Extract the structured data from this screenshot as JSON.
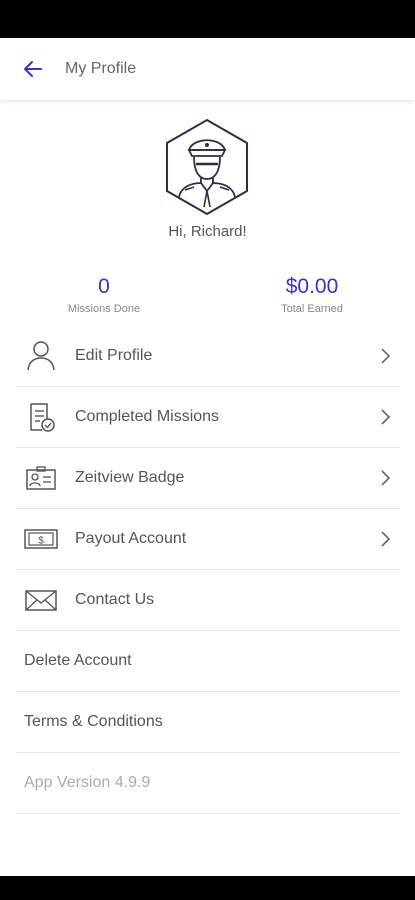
{
  "header": {
    "title": "My Profile",
    "back_icon": "arrow-left-icon",
    "accent_color": "#3d2fd1"
  },
  "profile": {
    "avatar_icon": "pilot-avatar-icon",
    "greeting": "Hi, Richard!"
  },
  "stats": {
    "missions_done": {
      "value": "0",
      "label": "Missions Done"
    },
    "total_earned": {
      "value": "$0.00",
      "label": "Total Earned"
    }
  },
  "menu": {
    "edit_profile": {
      "label": "Edit Profile",
      "icon": "person-icon"
    },
    "completed_missions": {
      "label": "Completed Missions",
      "icon": "checklist-icon"
    },
    "zeitview_badge": {
      "label": "Zeitview Badge",
      "icon": "id-badge-icon"
    },
    "payout_account": {
      "label": "Payout Account",
      "icon": "cash-icon"
    },
    "contact_us": {
      "label": "Contact Us",
      "icon": "envelope-icon"
    },
    "delete_account": {
      "label": "Delete Account"
    },
    "terms": {
      "label": "Terms & Conditions"
    },
    "app_version": {
      "label": "App Version 4.9.9"
    }
  }
}
